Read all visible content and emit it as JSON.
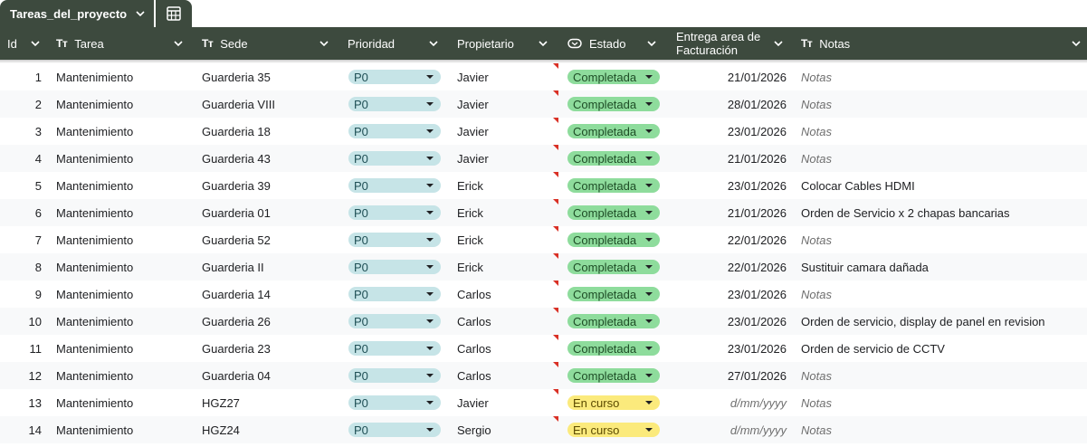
{
  "tab": {
    "name": "Tareas_del_proyecto"
  },
  "columns": {
    "id": "Id",
    "tarea": "Tarea",
    "sede": "Sede",
    "prioridad": "Prioridad",
    "propietario": "Propietario",
    "estado": "Estado",
    "entrega_line1": "Entrega area de",
    "entrega_line2": "Facturación",
    "notas": "Notas",
    "text_type_marker": "Tт"
  },
  "colors": {
    "header_bg": "#3d4a3e",
    "priority_chip": "#c6e4e7",
    "status_done": "#8edc9c",
    "status_in_progress": "#fbea7c",
    "comment_flag": "#d93025"
  },
  "rows": [
    {
      "id": "1",
      "tarea": "Mantenimiento",
      "sede": "Guarderia 35",
      "prioridad": "P0",
      "propietario": "Javier",
      "estado": "Completada",
      "fecha": "21/01/2026",
      "notas": "Notas"
    },
    {
      "id": "2",
      "tarea": "Mantenimiento",
      "sede": "Guarderia VIII",
      "prioridad": "P0",
      "propietario": "Javier",
      "estado": "Completada",
      "fecha": "28/01/2026",
      "notas": "Notas"
    },
    {
      "id": "3",
      "tarea": "Mantenimiento",
      "sede": "Guarderia 18",
      "prioridad": "P0",
      "propietario": "Javier",
      "estado": "Completada",
      "fecha": "23/01/2026",
      "notas": "Notas"
    },
    {
      "id": "4",
      "tarea": "Mantenimiento",
      "sede": "Guarderia 43",
      "prioridad": "P0",
      "propietario": "Javier",
      "estado": "Completada",
      "fecha": "21/01/2026",
      "notas": "Notas"
    },
    {
      "id": "5",
      "tarea": "Mantenimiento",
      "sede": "Guarderia 39",
      "prioridad": "P0",
      "propietario": "Erick",
      "estado": "Completada",
      "fecha": "23/01/2026",
      "notas": "Colocar Cables HDMI"
    },
    {
      "id": "6",
      "tarea": "Mantenimiento",
      "sede": "Guarderia 01",
      "prioridad": "P0",
      "propietario": "Erick",
      "estado": "Completada",
      "fecha": "21/01/2026",
      "notas": "Orden de Servicio x 2 chapas bancarias"
    },
    {
      "id": "7",
      "tarea": "Mantenimiento",
      "sede": "Guarderia 52",
      "prioridad": "P0",
      "propietario": "Erick",
      "estado": "Completada",
      "fecha": "22/01/2026",
      "notas": "Notas"
    },
    {
      "id": "8",
      "tarea": "Mantenimiento",
      "sede": "Guarderia II",
      "prioridad": "P0",
      "propietario": "Erick",
      "estado": "Completada",
      "fecha": "22/01/2026",
      "notas": "Sustituir camara dañada"
    },
    {
      "id": "9",
      "tarea": "Mantenimiento",
      "sede": "Guarderia 14",
      "prioridad": "P0",
      "propietario": "Carlos",
      "estado": "Completada",
      "fecha": "23/01/2026",
      "notas": "Notas"
    },
    {
      "id": "10",
      "tarea": "Mantenimiento",
      "sede": "Guarderia 26",
      "prioridad": "P0",
      "propietario": "Carlos",
      "estado": "Completada",
      "fecha": "23/01/2026",
      "notas": "Orden de servicio, display de panel en revision"
    },
    {
      "id": "11",
      "tarea": "Mantenimiento",
      "sede": "Guarderia 23",
      "prioridad": "P0",
      "propietario": "Carlos",
      "estado": "Completada",
      "fecha": "23/01/2026",
      "notas": "Orden de servicio de CCTV"
    },
    {
      "id": "12",
      "tarea": "Mantenimiento",
      "sede": "Guarderia 04",
      "prioridad": "P0",
      "propietario": "Carlos",
      "estado": "Completada",
      "fecha": "27/01/2026",
      "notas": "Notas"
    },
    {
      "id": "13",
      "tarea": "Mantenimiento",
      "sede": "HGZ27",
      "prioridad": "P0",
      "propietario": "Javier",
      "estado": "En curso",
      "fecha": "d/mm/yyyy",
      "notas": "Notas"
    },
    {
      "id": "14",
      "tarea": "Mantenimiento",
      "sede": "HGZ24",
      "prioridad": "P0",
      "propietario": "Sergio",
      "estado": "En curso",
      "fecha": "d/mm/yyyy",
      "notas": "Notas"
    }
  ],
  "placeholders": {
    "fecha": "d/mm/yyyy",
    "notas": "Notas"
  },
  "status_values": {
    "done": "Completada",
    "in_progress": "En curso"
  }
}
